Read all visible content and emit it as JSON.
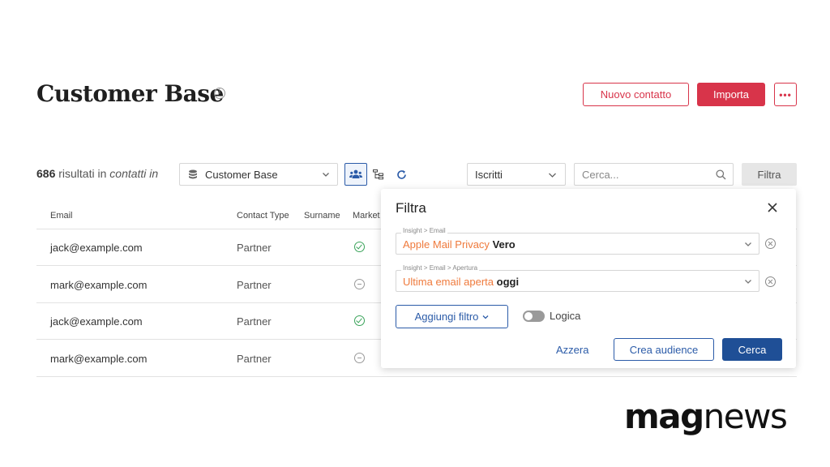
{
  "header": {
    "title": "Customer Base",
    "info_icon": "info-icon",
    "new_contact_label": "Nuovo contatto",
    "import_label": "Importa",
    "more_label": "•••"
  },
  "toolbar": {
    "results_count": "686",
    "results_mid": "risultati in",
    "results_scope": "contatti in",
    "database_value": "Customer Base",
    "status_value": "Iscritti",
    "search_placeholder": "Cerca...",
    "filter_label": "Filtra"
  },
  "table": {
    "columns": [
      "Email",
      "Contact Type",
      "Surname",
      "Market"
    ],
    "rows": [
      {
        "email": "jack@example.com",
        "type": "Partner",
        "marketing": "check"
      },
      {
        "email": "mark@example.com",
        "type": "Partner",
        "marketing": "minus"
      },
      {
        "email": "jack@example.com",
        "type": "Partner",
        "marketing": "check"
      },
      {
        "email": "mark@example.com",
        "type": "Partner",
        "marketing": "minus"
      }
    ]
  },
  "filter_panel": {
    "title": "Filtra",
    "filters": [
      {
        "path": "Insight > Email",
        "key": "Apple Mail Privacy",
        "value": "Vero"
      },
      {
        "path": "Insight > Email > Apertura",
        "key": "Ultima email aperta",
        "value": "oggi"
      }
    ],
    "add_filter_label": "Aggiungi filtro",
    "logic_label": "Logica",
    "logic_enabled": false,
    "reset_label": "Azzera",
    "create_audience_label": "Crea audience",
    "search_label": "Cerca"
  },
  "brand": {
    "logo_part1": "mag",
    "logo_part2": "news"
  },
  "colors": {
    "accent_red": "#d8344a",
    "accent_blue": "#2b5ba8",
    "filter_key_orange": "#ef7a3c",
    "status_green": "#3aa35a"
  }
}
